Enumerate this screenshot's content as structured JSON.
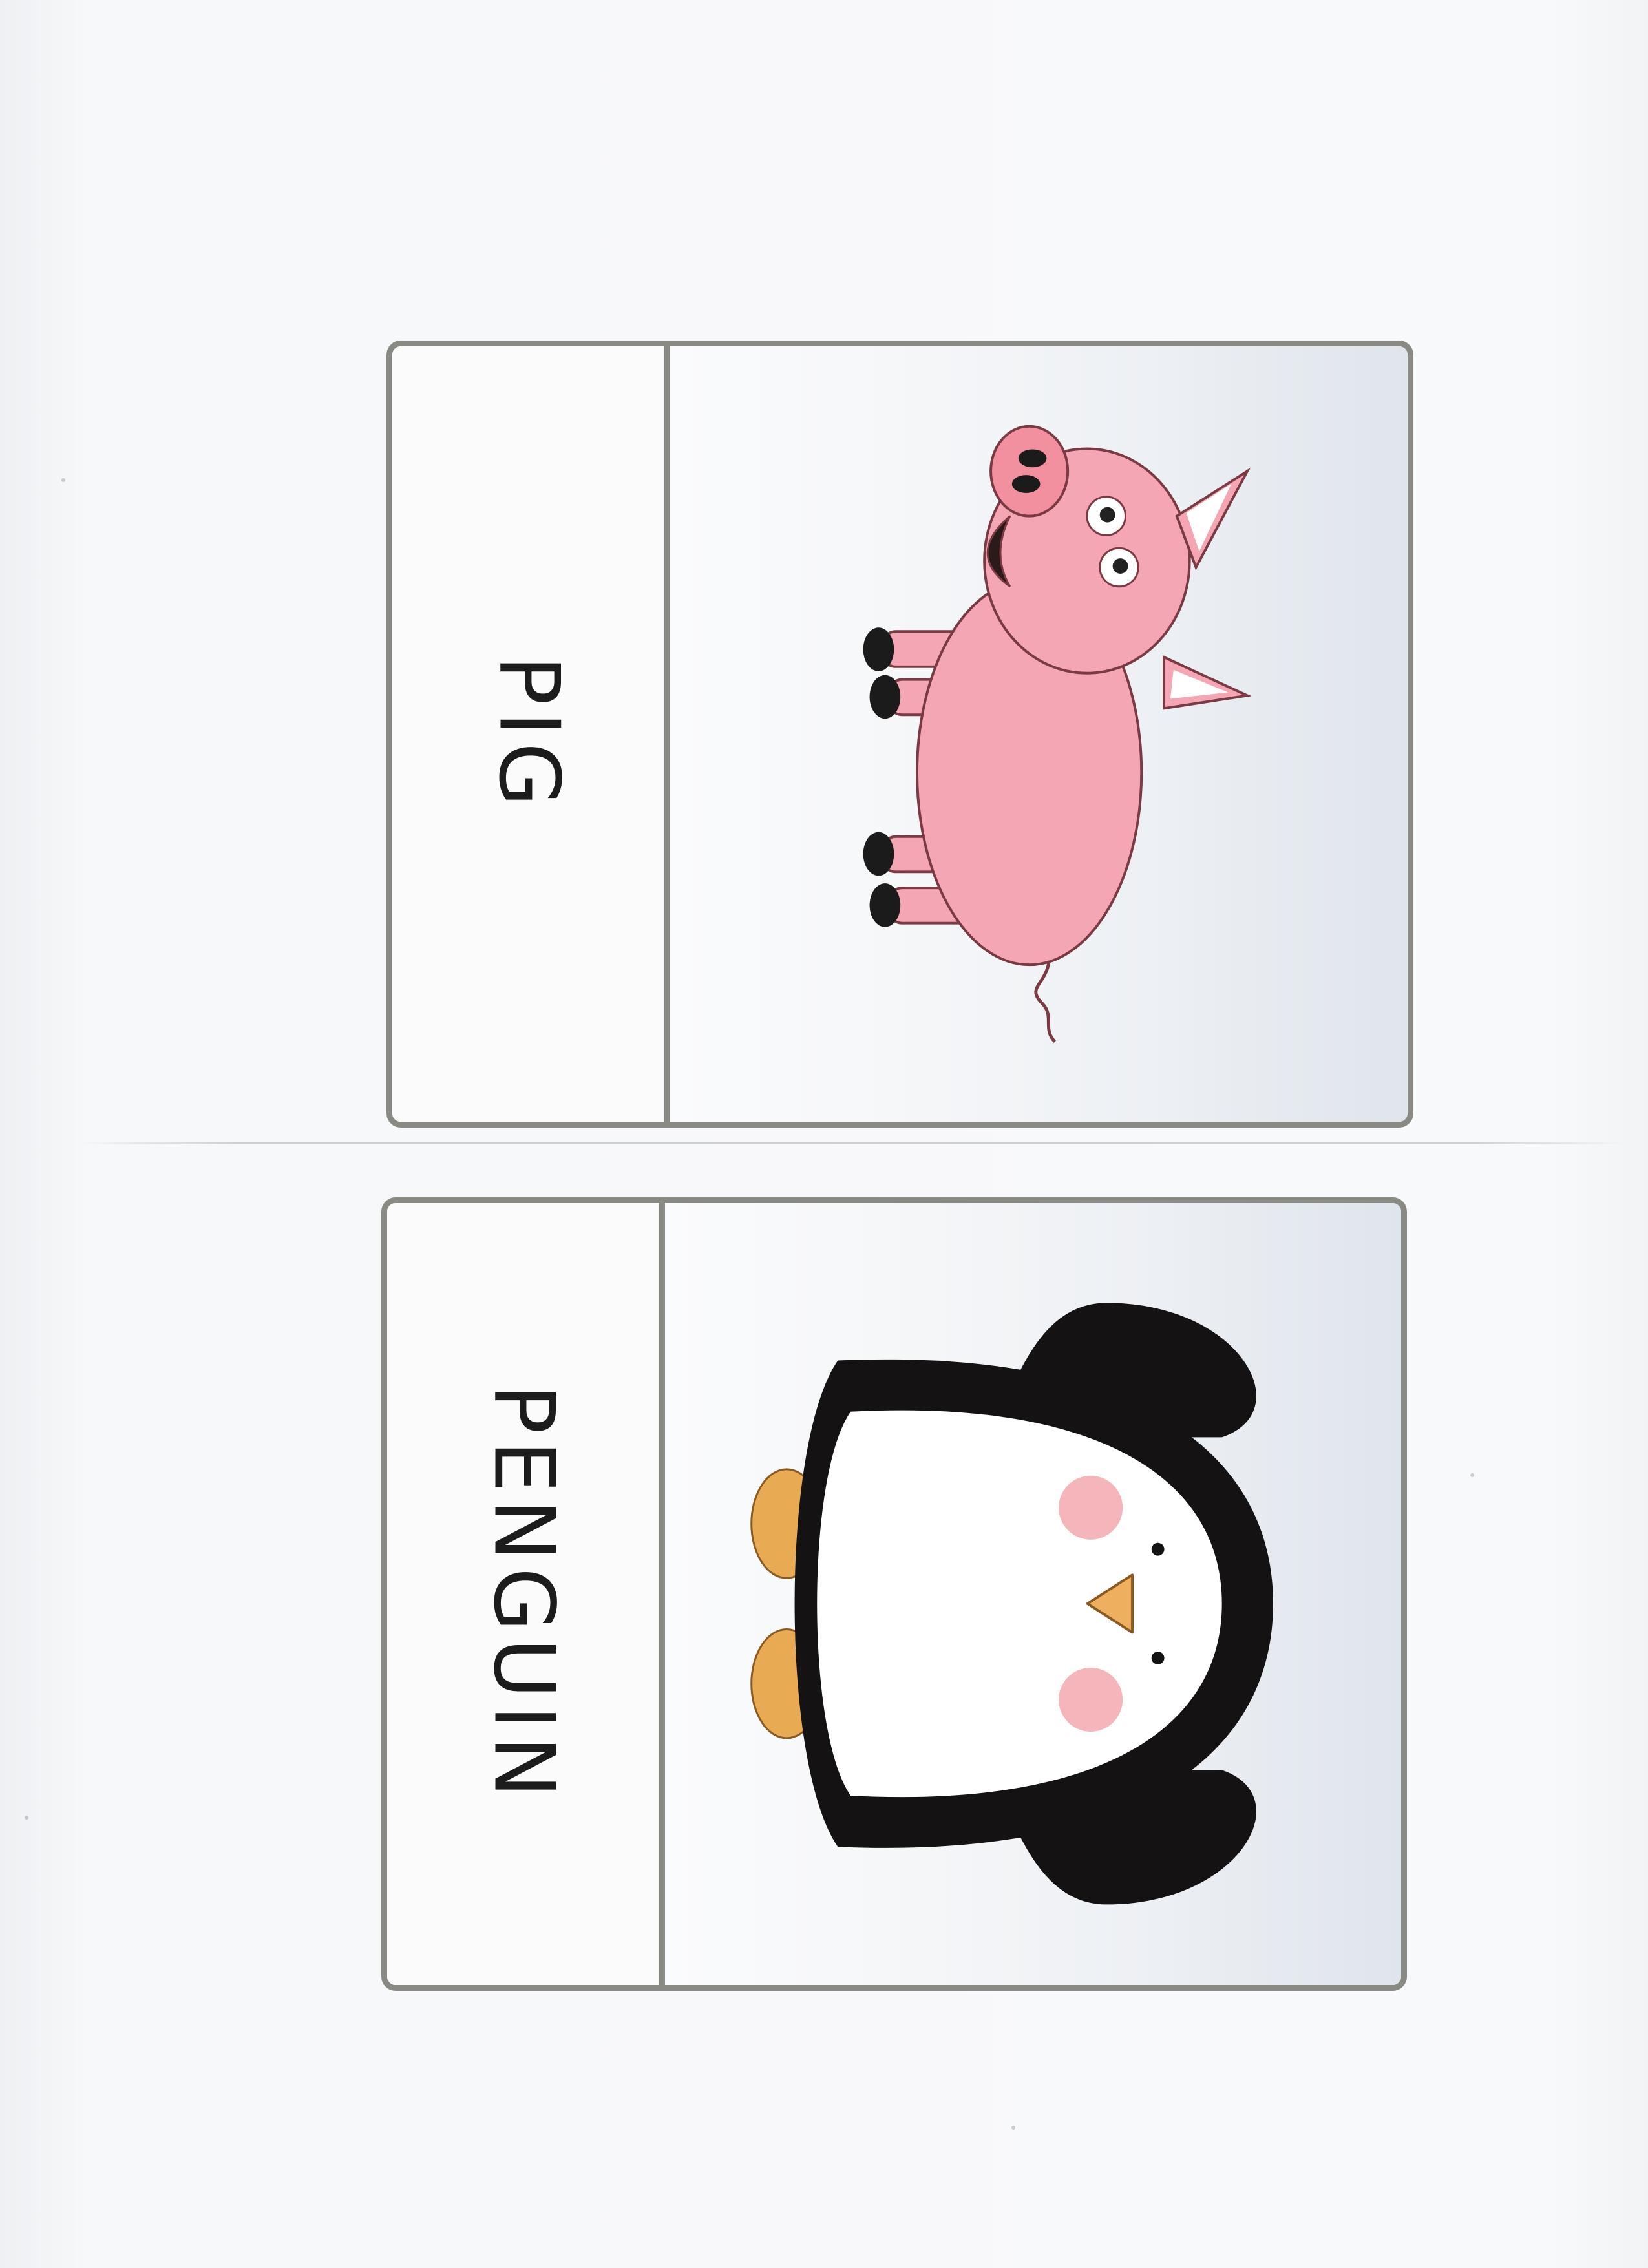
{
  "cards": [
    {
      "word": "PIG",
      "animal": "pig",
      "colors": {
        "body": "#f4a6b4",
        "outline": "#7a3a44",
        "hoof": "#1b1b1b",
        "inner_ear": "#ffffff"
      }
    },
    {
      "word": "PENGUIN",
      "animal": "penguin",
      "colors": {
        "body": "#151213",
        "belly": "#ffffff",
        "beak": "#eeb05f",
        "cheeks": "#f4b6bb",
        "feet": "#e8aa52"
      }
    }
  ],
  "colors": {
    "card_border": "#8a8a84",
    "paper": "#f7f8fa",
    "sky_gradient": "#dfe5ec"
  }
}
